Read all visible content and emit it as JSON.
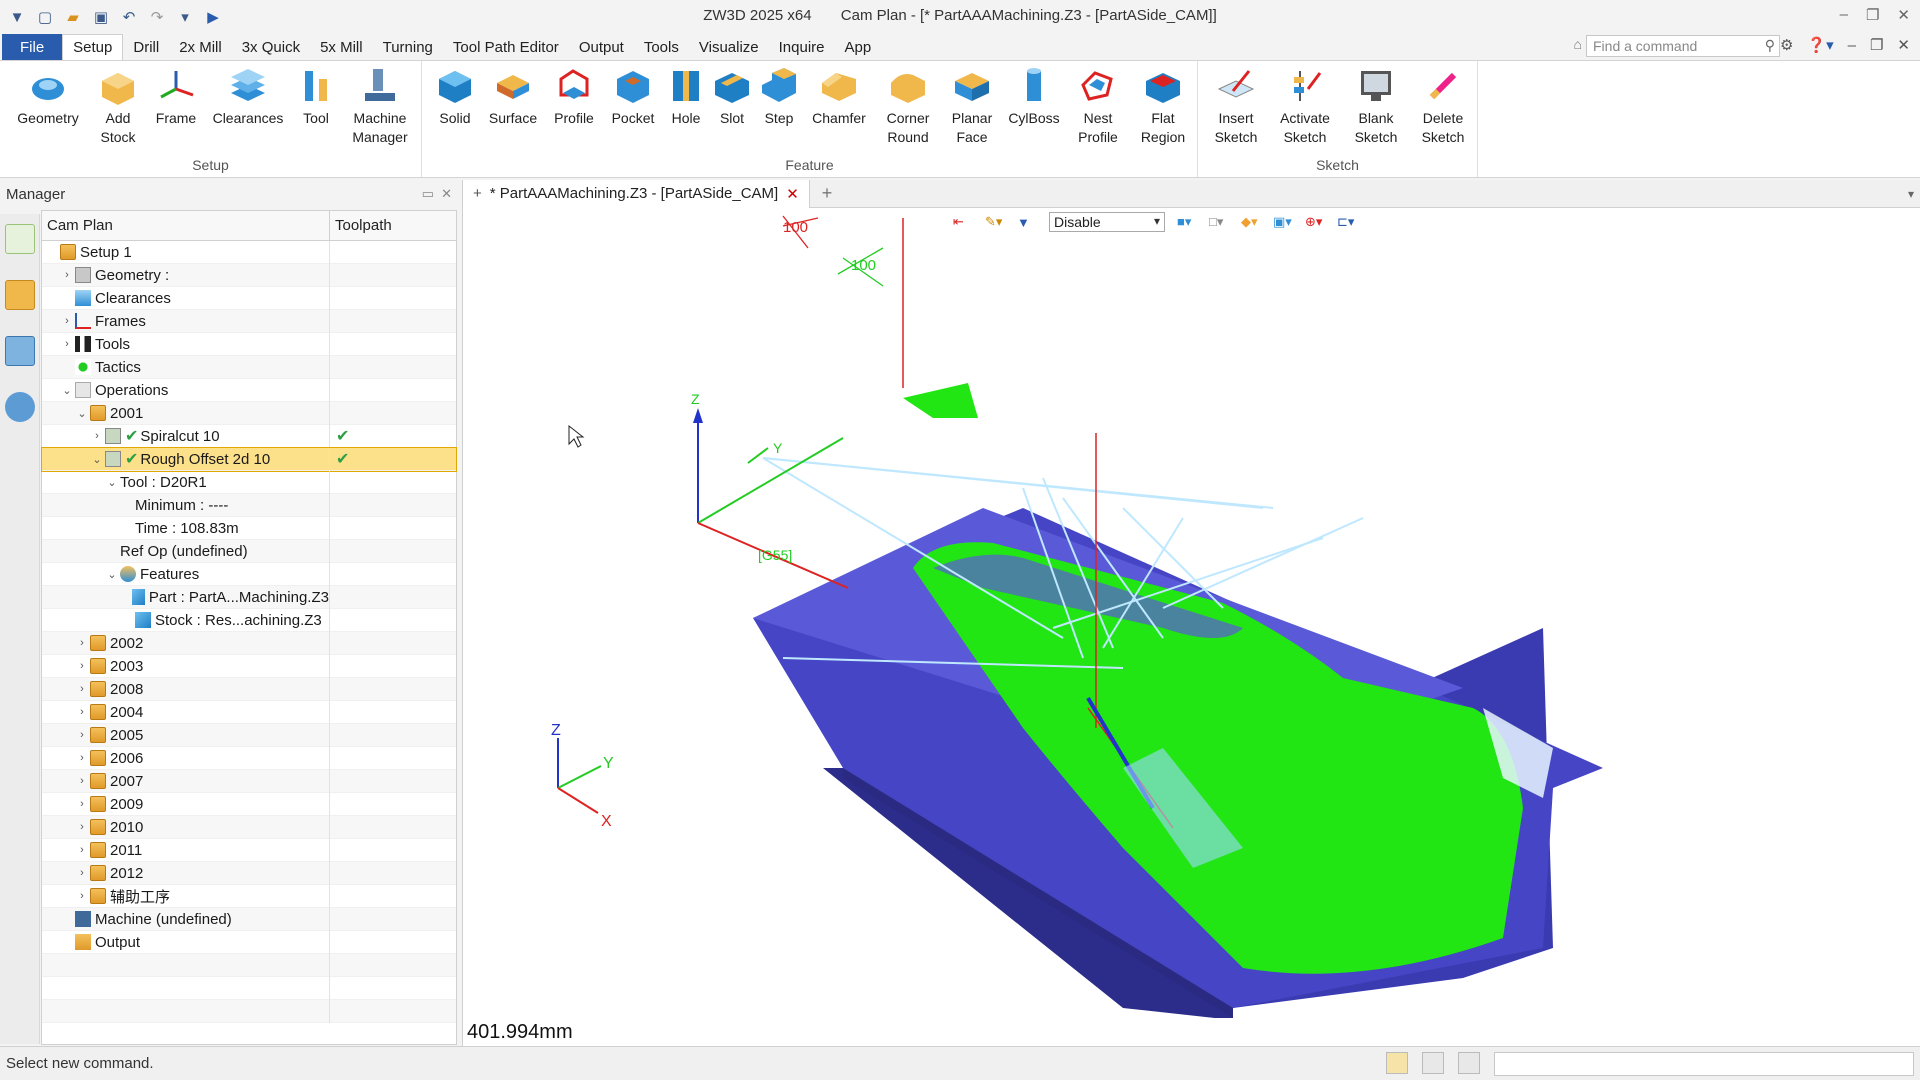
{
  "titlebar": {
    "title": "ZW3D 2025 x64",
    "document": "Cam Plan - [* PartAAAMachining.Z3 - [PartASide_CAM]]"
  },
  "menu": {
    "tabs": [
      "File",
      "Setup",
      "Drill",
      "2x Mill",
      "3x Quick",
      "5x Mill",
      "Turning",
      "Tool Path Editor",
      "Output",
      "Tools",
      "Visualize",
      "Inquire",
      "App"
    ],
    "active": "Setup",
    "search_placeholder": "Find a command"
  },
  "ribbon": {
    "groups": {
      "setup": "Setup",
      "feature": "Feature",
      "sketch": "Sketch"
    },
    "setup_buttons": [
      "Geometry",
      "Add Stock",
      "Frame",
      "Clearances",
      "Tool",
      "Machine Manager"
    ],
    "feature_buttons": [
      "Solid",
      "Surface",
      "Profile",
      "Pocket",
      "Hole",
      "Slot",
      "Step",
      "Chamfer",
      "Corner Round",
      "Planar Face",
      "CylBoss",
      "Nest Profile",
      "Flat Region"
    ],
    "sketch_buttons": [
      "Insert Sketch",
      "Activate Sketch",
      "Blank Sketch",
      "Delete Sketch"
    ]
  },
  "manager": {
    "title": "Manager",
    "columns": [
      "Cam Plan",
      "Toolpath"
    ],
    "rows": [
      {
        "label": "Setup 1",
        "check": ""
      },
      {
        "label": "Geometry :",
        "check": ""
      },
      {
        "label": "Clearances",
        "check": ""
      },
      {
        "label": "Frames",
        "check": ""
      },
      {
        "label": "Tools",
        "check": ""
      },
      {
        "label": "Tactics",
        "check": ""
      },
      {
        "label": "Operations",
        "check": ""
      },
      {
        "label": "2001",
        "check": ""
      },
      {
        "label": "Spiralcut 10",
        "check": "✔"
      },
      {
        "label": "Rough Offset 2d 10",
        "check": "✔"
      },
      {
        "label": "Tool : D20R1",
        "check": ""
      },
      {
        "label": "Minimum : ----",
        "check": ""
      },
      {
        "label": "Time : 108.83m",
        "check": ""
      },
      {
        "label": "Ref Op (undefined)",
        "check": ""
      },
      {
        "label": "Features",
        "check": ""
      },
      {
        "label": "Part : PartA...Machining.Z3",
        "check": ""
      },
      {
        "label": "Stock : Res...achining.Z3",
        "check": ""
      },
      {
        "label": "2002",
        "check": ""
      },
      {
        "label": "2003",
        "check": ""
      },
      {
        "label": "2008",
        "check": ""
      },
      {
        "label": "2004",
        "check": ""
      },
      {
        "label": "2005",
        "check": ""
      },
      {
        "label": "2006",
        "check": ""
      },
      {
        "label": "2007",
        "check": ""
      },
      {
        "label": "2009",
        "check": ""
      },
      {
        "label": "2010",
        "check": ""
      },
      {
        "label": "2011",
        "check": ""
      },
      {
        "label": "2012",
        "check": ""
      },
      {
        "label": "辅助工序",
        "check": ""
      },
      {
        "label": "Machine (undefined)",
        "check": ""
      },
      {
        "label": "Output",
        "check": ""
      }
    ]
  },
  "viewport": {
    "tab_label": "* PartAAAMachining.Z3 - [PartASide_CAM]",
    "filter_value": "Disable",
    "measurement": "401.994mm",
    "dim_labels": [
      "100",
      "100"
    ],
    "frame_label": "[G55]",
    "axes": {
      "x": "X",
      "y": "Y",
      "z": "Z"
    }
  },
  "status": {
    "text": "Select new command."
  }
}
